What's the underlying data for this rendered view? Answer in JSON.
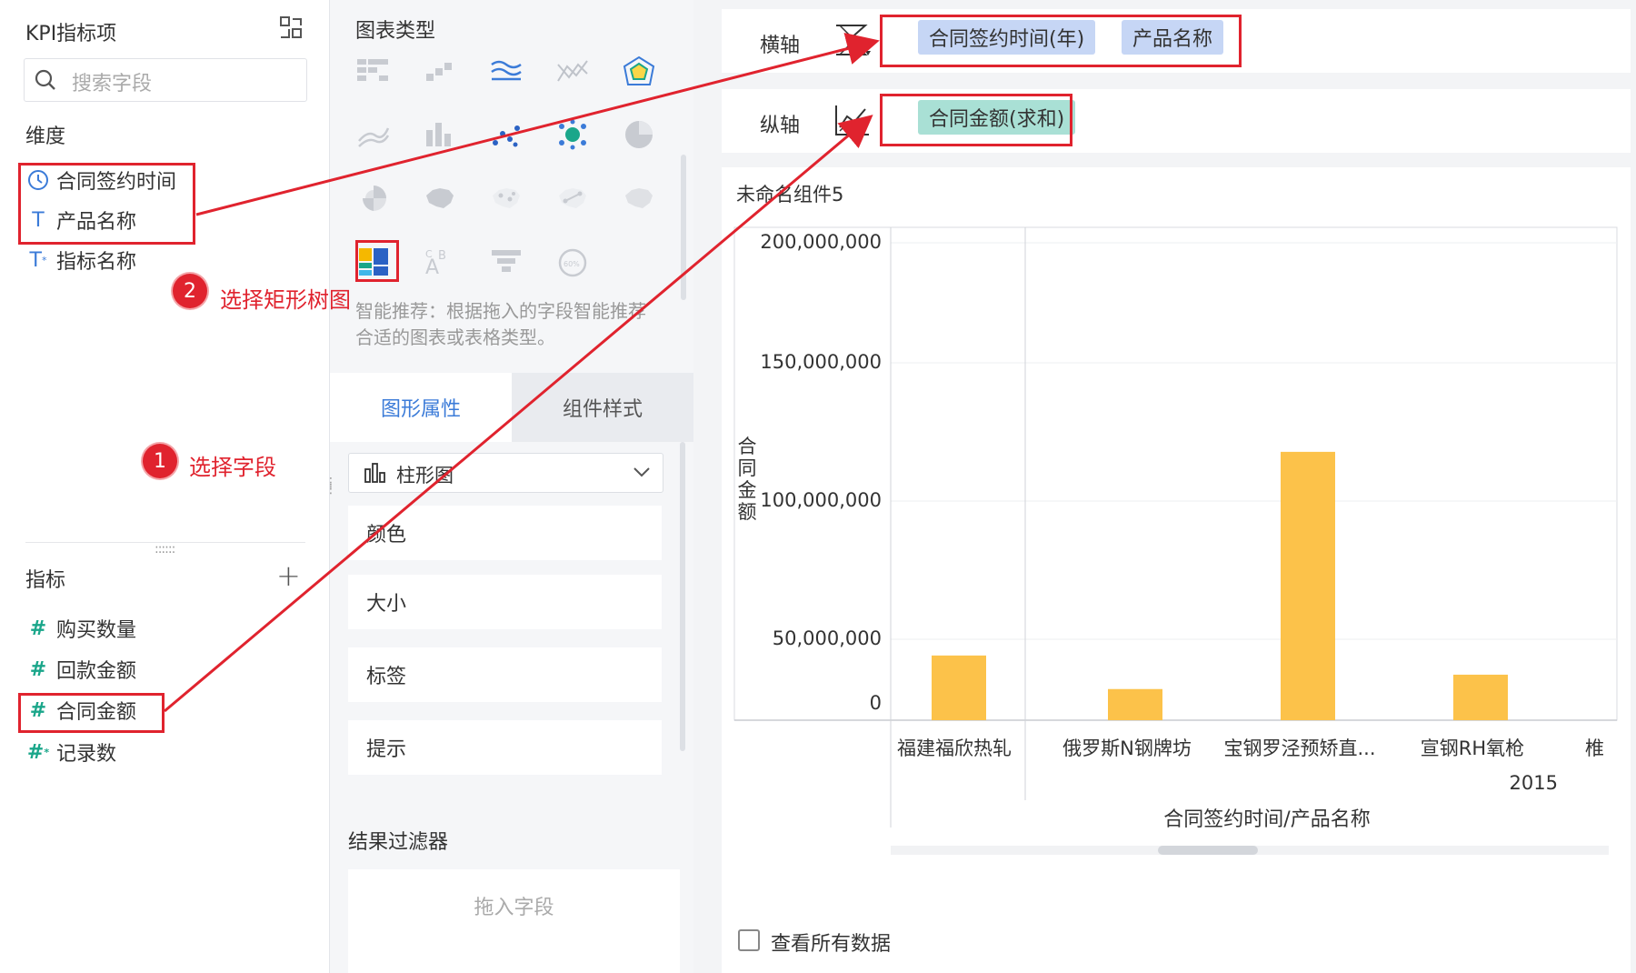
{
  "left_panel": {
    "title": "KPI指标项",
    "search_placeholder": "搜索字段",
    "dimensions_title": "维度",
    "dimensions": [
      {
        "label": "合同签约时间",
        "icon": "clock-icon"
      },
      {
        "label": "产品名称",
        "icon": "text-type-icon"
      },
      {
        "label": "指标名称",
        "icon": "text-type-starred-icon"
      }
    ],
    "measures_title": "指标",
    "measures": [
      {
        "label": "购买数量",
        "icon": "hash-icon"
      },
      {
        "label": "回款金额",
        "icon": "hash-icon"
      },
      {
        "label": "合同金额",
        "icon": "hash-icon"
      },
      {
        "label": "记录数",
        "icon": "hash-starred-icon"
      }
    ]
  },
  "middle_panel": {
    "chart_type_title": "图表类型",
    "smart_tip": "智能推荐：根据拖入的字段智能推荐合适的图表或表格类型。",
    "tabs": [
      "图形属性",
      "组件样式"
    ],
    "chart_select_value": "柱形图",
    "properties": [
      "颜色",
      "大小",
      "标签",
      "提示"
    ],
    "filter_title": "结果过滤器",
    "filter_placeholder": "拖入字段"
  },
  "axes": {
    "x_label": "横轴",
    "x_fields": [
      "合同签约时间(年)",
      "产品名称"
    ],
    "y_label": "纵轴",
    "y_fields": [
      "合同金额(求和)"
    ]
  },
  "chart_card": {
    "title": "未命名组件5",
    "view_all_label": "查看所有数据"
  },
  "annotations": {
    "step1_num": "1",
    "step1_text": "选择字段",
    "step2_num": "2",
    "step2_text": "选择矩形树图",
    "color": "#e0232e"
  },
  "colors": {
    "accent": "#3b7bd8",
    "bar": "#fcc24a",
    "pill_blue": "#c6d6f5",
    "pill_green": "#a9e0d5"
  },
  "chart_data": {
    "type": "bar",
    "categories": [
      "福建福欣热轧",
      "俄罗斯N钢牌坊",
      "宝钢罗泾预矫直...",
      "宣钢RH氧枪",
      "椎"
    ],
    "group_label": "2015",
    "values": [
      27000000,
      13000000,
      112000000,
      19000000,
      null
    ],
    "ylabel": "合同金额",
    "xlabel": "合同签约时间/产品名称",
    "yticks": [
      "200,000,000",
      "150,000,000",
      "100,000,000",
      "50,000,000",
      "0"
    ],
    "ylim": [
      0,
      200000000
    ],
    "grid": true
  }
}
